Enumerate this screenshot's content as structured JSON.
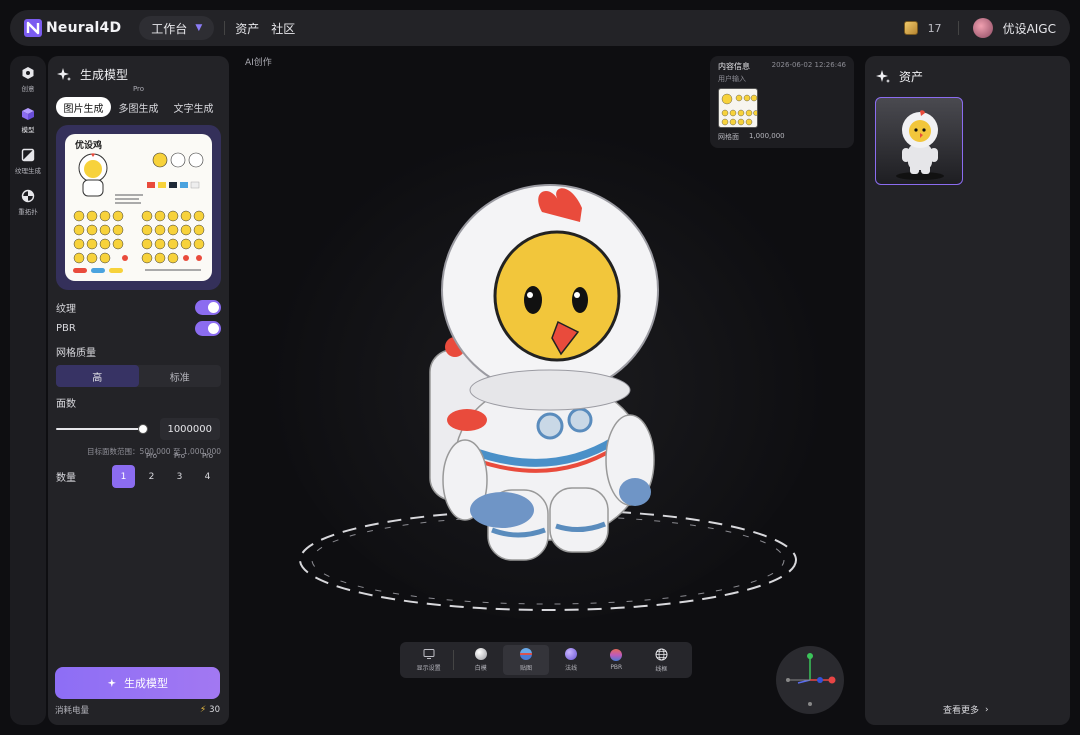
{
  "topbar": {
    "brand": "Neural4D",
    "workspace_label": "工作台",
    "nav": [
      "资产",
      "社区"
    ],
    "coin_count": "17",
    "user_name": "优设AIGC"
  },
  "rail": [
    {
      "label": "创意",
      "icon": "hexagon-icon"
    },
    {
      "label": "模型",
      "icon": "cube-icon"
    },
    {
      "label": "纹理生成",
      "icon": "texture-icon"
    },
    {
      "label": "重拓扑",
      "icon": "retopology-icon"
    }
  ],
  "left_panel": {
    "title": "生成模型",
    "tabs": [
      {
        "label": "图片生成",
        "pro": ""
      },
      {
        "label": "多图生成",
        "pro": "Pro"
      },
      {
        "label": "文字生成",
        "pro": ""
      }
    ],
    "preview_title": "优设鸡",
    "texture_label": "纹理",
    "pbr_label": "PBR",
    "mesh_quality_label": "网格质量",
    "quality_options": [
      "高",
      "标准"
    ],
    "faces_label": "面数",
    "faces_value": "1000000",
    "faces_slider_fraction": 1.0,
    "faces_hint": "目标面数范围：500,000 至 1,000,000",
    "qty_label": "数量",
    "qty_options": [
      {
        "label": "1",
        "pro": ""
      },
      {
        "label": "2",
        "pro": "Pro"
      },
      {
        "label": "3",
        "pro": "Pro"
      },
      {
        "label": "4",
        "pro": "Pro"
      }
    ],
    "generate_label": "生成模型",
    "energy_label": "消耗电量",
    "energy_value": "30"
  },
  "viewport": {
    "label": "AI创作",
    "info": {
      "title": "内容信息",
      "time": "2026-06-02 12:26:46",
      "sub": "用户输入",
      "foot_label": "网格面",
      "foot_value": "1,000,000"
    },
    "render_modes": [
      {
        "label": "显示设置",
        "icon": "display-settings-icon"
      },
      {
        "label": "白模",
        "icon": "white-ball-icon"
      },
      {
        "label": "贴图",
        "icon": "textured-ball-icon"
      },
      {
        "label": "法线",
        "icon": "normal-ball-icon"
      },
      {
        "label": "PBR",
        "icon": "pbr-ball-icon"
      },
      {
        "label": "线框",
        "icon": "wireframe-globe-icon"
      }
    ]
  },
  "right_panel": {
    "title": "资产",
    "see_more": "查看更多"
  },
  "colors": {
    "accent": "#8b6cf0",
    "panel": "#232327",
    "background": "#0e0e11"
  }
}
